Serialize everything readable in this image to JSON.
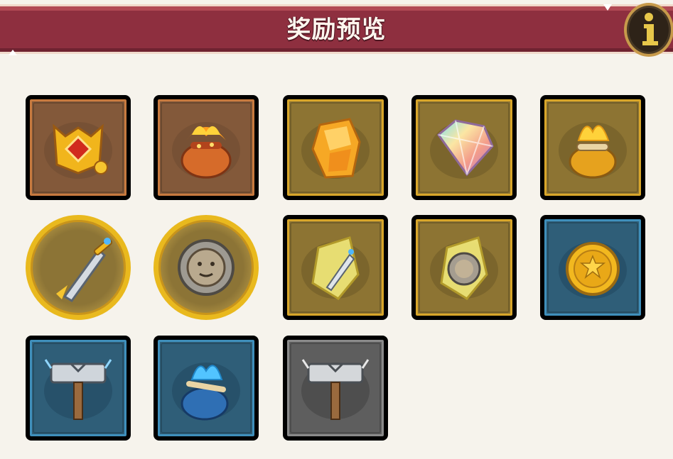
{
  "header": {
    "title": "奖励预览",
    "accent_color": "#8e2f3f",
    "info_icon": "info-icon"
  },
  "rewards": [
    {
      "icon": "gold-chest-armor-icon",
      "frame": "orange",
      "shape": "square"
    },
    {
      "icon": "flaming-treasure-bag-icon",
      "frame": "orange",
      "shape": "square"
    },
    {
      "icon": "amber-crystal-icon",
      "frame": "gold",
      "shape": "square"
    },
    {
      "icon": "rainbow-diamond-icon",
      "frame": "gold",
      "shape": "square"
    },
    {
      "icon": "gold-flame-bag-icon",
      "frame": "gold",
      "shape": "square"
    },
    {
      "icon": "golden-sword-icon",
      "frame": "gold",
      "shape": "circle"
    },
    {
      "icon": "lion-shield-icon",
      "frame": "gold",
      "shape": "circle"
    },
    {
      "icon": "sword-crystal-shard-icon",
      "frame": "gold",
      "shape": "square"
    },
    {
      "icon": "shield-crystal-shard-icon",
      "frame": "gold",
      "shape": "square"
    },
    {
      "icon": "sun-gold-coin-icon",
      "frame": "blue",
      "shape": "square"
    },
    {
      "icon": "blue-war-hammer-icon",
      "frame": "blue",
      "shape": "square"
    },
    {
      "icon": "blue-flame-bag-icon",
      "frame": "blue",
      "shape": "square"
    },
    {
      "icon": "gray-war-hammer-icon",
      "frame": "gray",
      "shape": "square"
    }
  ]
}
